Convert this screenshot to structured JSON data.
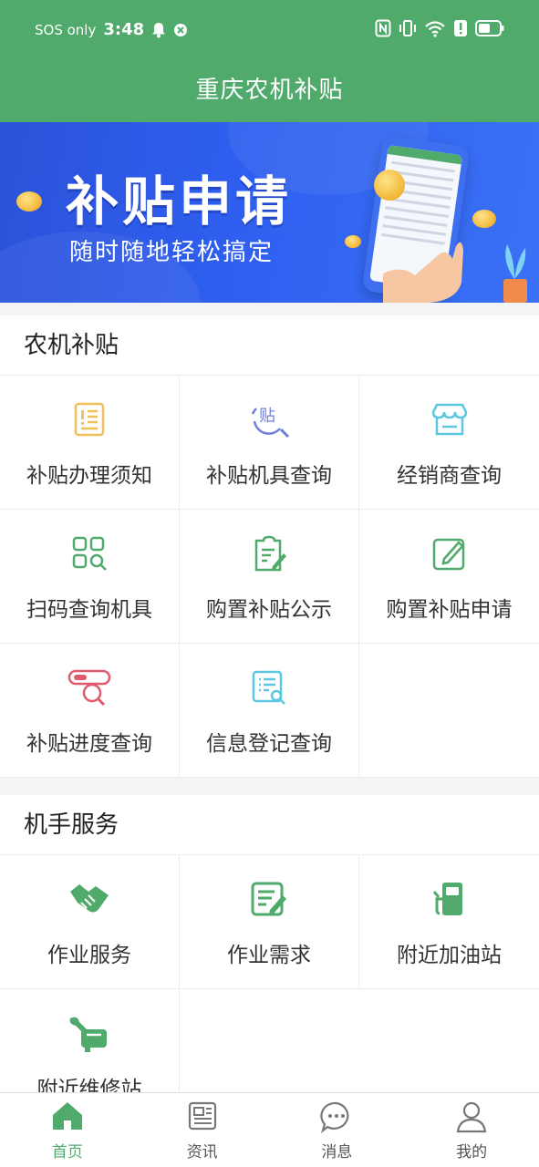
{
  "status_bar": {
    "carrier": "SOS only",
    "time": "3:48"
  },
  "header": {
    "title": "重庆农机补贴"
  },
  "banner": {
    "title": "补贴申请",
    "subtitle": "随时随地轻松搞定"
  },
  "sections": {
    "subsidy": {
      "title": "农机补贴",
      "items": [
        {
          "label": "补贴办理须知",
          "icon": "notice-doc-icon",
          "color": "#f0c05a"
        },
        {
          "label": "补贴机具查询",
          "icon": "subsidy-search-icon",
          "color": "#6f7fd6"
        },
        {
          "label": "经销商查询",
          "icon": "store-icon",
          "color": "#5bc7e0"
        },
        {
          "label": "扫码查询机具",
          "icon": "scan-grid-icon",
          "color": "#4faa6b"
        },
        {
          "label": "购置补贴公示",
          "icon": "clipboard-edit-icon",
          "color": "#4faa6b"
        },
        {
          "label": "购置补贴申请",
          "icon": "edit-form-icon",
          "color": "#4faa6b"
        },
        {
          "label": "补贴进度查询",
          "icon": "progress-search-icon",
          "color": "#e05a6e"
        },
        {
          "label": "信息登记查询",
          "icon": "list-search-icon",
          "color": "#5bc7e0"
        }
      ]
    },
    "operator": {
      "title": "机手服务",
      "items": [
        {
          "label": "作业服务",
          "icon": "handshake-icon",
          "color": "#4faa6b"
        },
        {
          "label": "作业需求",
          "icon": "note-edit-icon",
          "color": "#4faa6b"
        },
        {
          "label": "附近加油站",
          "icon": "gas-station-icon",
          "color": "#4faa6b"
        },
        {
          "label": "附近维修站",
          "icon": "repair-wrench-icon",
          "color": "#4faa6b"
        }
      ]
    }
  },
  "bottom_nav": {
    "items": [
      {
        "label": "首页",
        "icon": "home-icon",
        "active": true
      },
      {
        "label": "资讯",
        "icon": "news-icon",
        "active": false
      },
      {
        "label": "消息",
        "icon": "chat-icon",
        "active": false
      },
      {
        "label": "我的",
        "icon": "user-icon",
        "active": false
      }
    ]
  },
  "colors": {
    "brand_green": "#4faa6b",
    "banner_blue": "#2f5ff0"
  }
}
